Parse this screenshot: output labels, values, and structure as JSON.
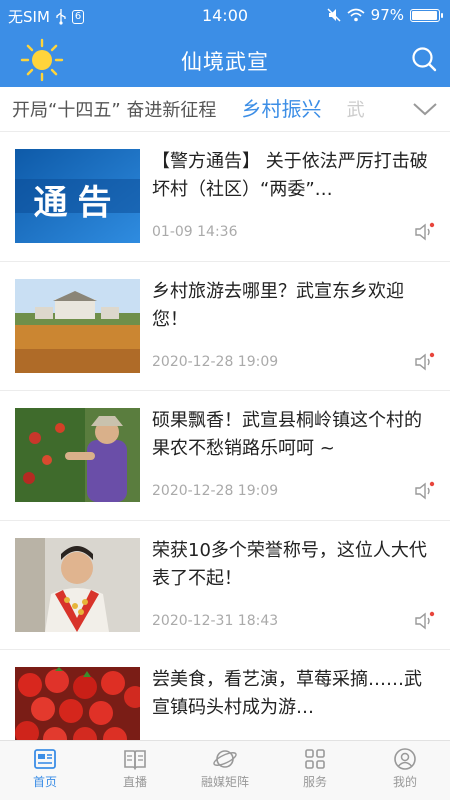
{
  "status_bar": {
    "carrier": "无SIM",
    "sim_badge": "6",
    "time": "14:00",
    "battery": "97%",
    "battery_level": 0.97
  },
  "header": {
    "title": "仙境武宣",
    "left_icon": "sun-icon",
    "right_icon": "search-icon"
  },
  "channels": [
    {
      "label": "开局“十四五” 奋进新征程",
      "active": false
    },
    {
      "label": "乡村振兴",
      "active": true
    },
    {
      "label": "武",
      "active": false
    }
  ],
  "news": [
    {
      "headline": "【警方通告】 关于依法严厉打击破坏村（社区）“两委”…",
      "time": "01-09 14:36",
      "thumb_text": "通告"
    },
    {
      "headline": "乡村旅游去哪里？武宣东乡欢迎您！",
      "time": "2020-12-28 19:09"
    },
    {
      "headline": "硕果飘香！武宣县桐岭镇这个村的果农不愁销路乐呵呵 ~",
      "time": "2020-12-28 19:09"
    },
    {
      "headline": "荣获10多个荣誉称号，这位人大代表了不起！",
      "time": "2020-12-31 18:43"
    },
    {
      "headline": "尝美食，看艺演，草莓采摘……武宣镇码头村成为游…",
      "time": ""
    }
  ],
  "tab_bar": [
    {
      "label": "首页",
      "icon": "home-icon",
      "active": true
    },
    {
      "label": "直播",
      "icon": "book-icon",
      "active": false
    },
    {
      "label": "融媒矩阵",
      "icon": "planet-icon",
      "active": false
    },
    {
      "label": "服务",
      "icon": "grid-icon",
      "active": false
    },
    {
      "label": "我的",
      "icon": "user-icon",
      "active": false
    }
  ],
  "colors": {
    "brand_blue": "#3c8ee6",
    "sun_yellow": "#ffd43b",
    "badge_red": "#e8453c"
  }
}
